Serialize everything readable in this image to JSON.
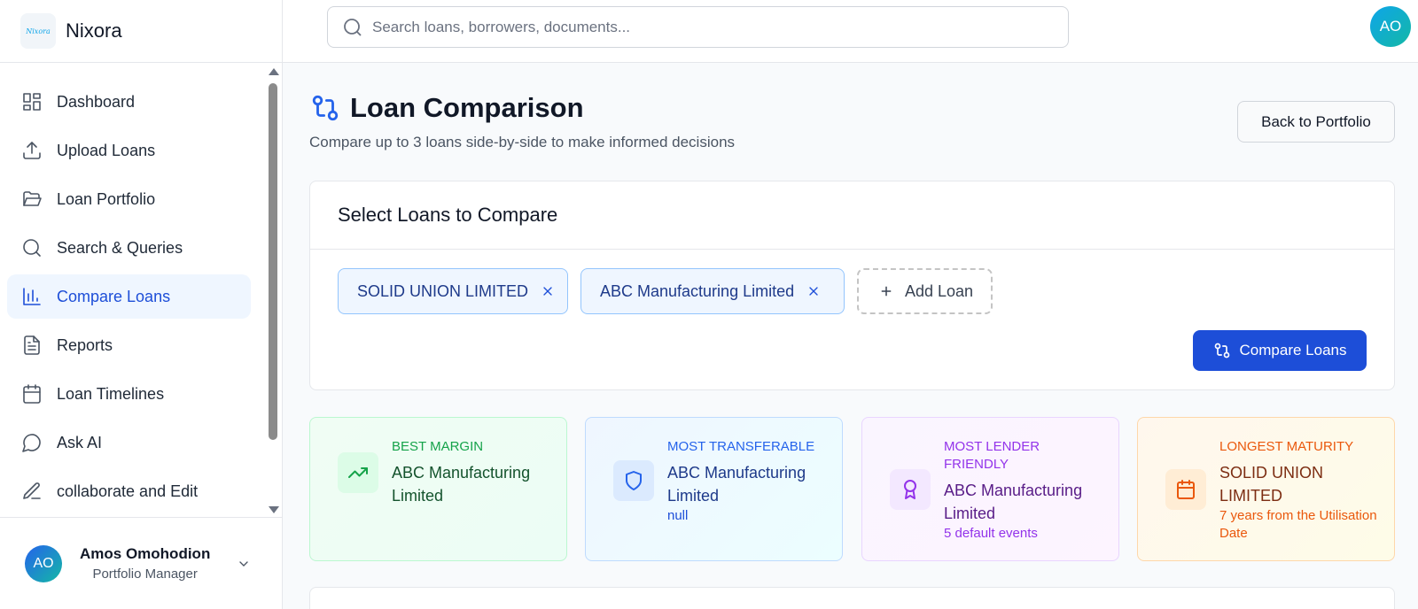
{
  "app": {
    "name": "Nixora",
    "logo_text": "Nixora"
  },
  "search": {
    "placeholder": "Search loans, borrowers, documents..."
  },
  "top_avatar": "AO",
  "sidebar": {
    "items": [
      {
        "label": "Dashboard",
        "icon": "dashboard-icon"
      },
      {
        "label": "Upload Loans",
        "icon": "upload-icon"
      },
      {
        "label": "Loan Portfolio",
        "icon": "folder-icon"
      },
      {
        "label": "Search & Queries",
        "icon": "search-icon"
      },
      {
        "label": "Compare Loans",
        "icon": "bar-chart-icon",
        "active": true
      },
      {
        "label": "Reports",
        "icon": "document-icon"
      },
      {
        "label": "Loan Timelines",
        "icon": "calendar-icon"
      },
      {
        "label": "Ask AI",
        "icon": "chat-icon"
      },
      {
        "label": "collaborate and Edit",
        "icon": "pen-icon"
      }
    ]
  },
  "user": {
    "initials": "AO",
    "name": "Amos Omohodion",
    "role": "Portfolio Manager"
  },
  "page": {
    "title": "Loan Comparison",
    "subtitle": "Compare up to 3 loans side-by-side to make informed decisions",
    "back_label": "Back to Portfolio"
  },
  "select": {
    "heading": "Select Loans to Compare",
    "chips": [
      "SOLID UNION LIMITED",
      "ABC Manufacturing Limited"
    ],
    "add_label": "Add Loan",
    "compare_label": "Compare Loans"
  },
  "stats": [
    {
      "label": "BEST MARGIN",
      "value": "ABC Manufacturing Limited",
      "note": "",
      "icon": "trending-up-icon",
      "color": "#16a34a"
    },
    {
      "label": "MOST TRANSFERABLE",
      "value": "ABC Manufacturing Limited",
      "note": "null",
      "icon": "shield-icon",
      "color": "#2563eb"
    },
    {
      "label": "MOST LENDER FRIENDLY",
      "value": "ABC Manufacturing Limited",
      "note": "5 default events",
      "icon": "award-icon",
      "color": "#9333ea"
    },
    {
      "label": "LONGEST MATURITY",
      "value": "SOLID UNION LIMITED",
      "note": "7 years from the Utilisation Date",
      "icon": "calendar-icon",
      "color": "#ea580c"
    }
  ]
}
